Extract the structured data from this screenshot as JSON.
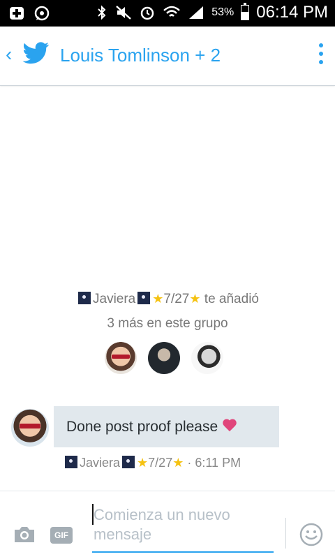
{
  "status_bar": {
    "battery_percent": "53%",
    "time": "06:14 PM",
    "icons": [
      "plus-box-icon",
      "whatsapp-icon",
      "bluetooth-icon",
      "mute-icon",
      "alarm-icon",
      "wifi-icon",
      "signal-icon",
      "battery-icon"
    ],
    "battery_level": 0.53
  },
  "app_bar": {
    "back_icon": "chevron-left-icon",
    "logo_icon": "twitter-bird-icon",
    "title": "Louis Tomlinson + 2",
    "menu_icon": "more-vertical-icon",
    "accent_color": "#2aa3ef"
  },
  "system_message": {
    "actor_name": "Javiera",
    "actor_suffix": "7/27",
    "action": "te añadió",
    "line2": "3 más en este grupo"
  },
  "message": {
    "text": "Done post proof please",
    "emoji": "sparkling-heart-icon",
    "sender": "Javiera",
    "sender_suffix": "7/27",
    "time": "· 6:11 PM",
    "bubble_color": "#e1e8ed"
  },
  "composer": {
    "camera_icon": "camera-icon",
    "gif_label": "GIF",
    "placeholder": "Comienza un nuevo\nmensaje",
    "emoji_icon": "smiley-icon"
  }
}
